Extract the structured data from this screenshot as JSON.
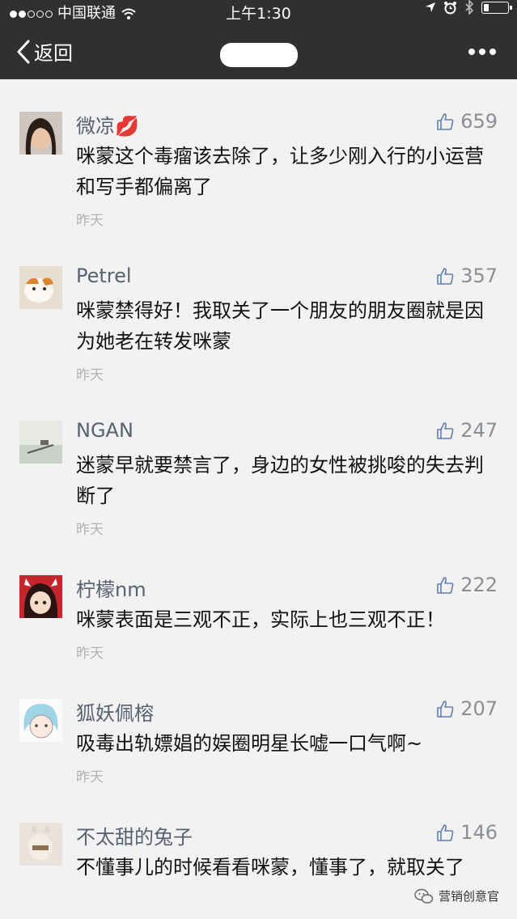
{
  "status_bar": {
    "carrier": "中国联通",
    "time": "上午1:30"
  },
  "nav": {
    "back_label": "返回"
  },
  "comments": [
    {
      "name": "微凉💋",
      "likes": "659",
      "text": "咪蒙这个毒瘤该去除了，让多少刚入行的小运营和写手都偏离了",
      "date": "昨天"
    },
    {
      "name": "Petrel",
      "likes": "357",
      "text": "咪蒙禁得好！我取关了一个朋友的朋友圈就是因为她老在转发咪蒙",
      "date": "昨天"
    },
    {
      "name": "NGAN",
      "likes": "247",
      "text": "迷蒙早就要禁言了，身边的女性被挑唆的失去判断了",
      "date": "昨天"
    },
    {
      "name": "柠檬nm",
      "likes": "222",
      "text": "咪蒙表面是三观不正，实际上也三观不正！",
      "date": "昨天"
    },
    {
      "name": "狐妖佩榕",
      "likes": "207",
      "text": "吸毒出轨嫖娼的娱圈明星长嘘一口气啊~",
      "date": "昨天"
    },
    {
      "name": "不太甜的兔子",
      "likes": "146",
      "text": "不懂事儿的时候看看咪蒙，懂事了，就取关了",
      "date": ""
    }
  ],
  "watermark": {
    "text": "营销创意官"
  }
}
